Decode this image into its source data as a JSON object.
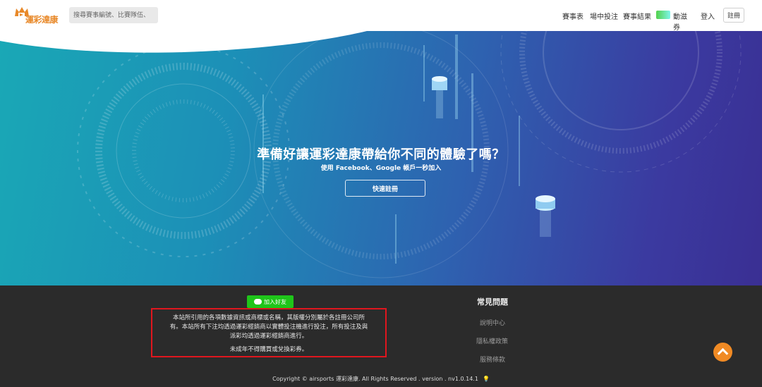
{
  "header": {
    "logo_text": "運彩達康",
    "search_placeholder": "搜尋賽事編號、比賽隊伍、",
    "nav": {
      "schedule": "賽事表",
      "betting": "場中投注",
      "results": "賽事結果",
      "promo_text": "動滋券",
      "login": "登入",
      "register": "註冊"
    }
  },
  "hero": {
    "title": "準備好讓運彩達康帶給你不同的體驗了嗎？",
    "subtitle": "使用 Facebook、Google 帳戶一秒加入",
    "button": "快速註冊"
  },
  "footer": {
    "line_button": "加入好友",
    "disclaimer_line1": "本站所引用的各項數據資訊或商標或名稱，其版權分別屬於各註冊公司所",
    "disclaimer_line2": "有。本站所有下注均透過運彩經銷商以實體投注機進行投注，所有投注及與",
    "disclaimer_line3": "派彩均透過運彩經銷商進行。",
    "disclaimer_line4": "未成年不得購買或兌換彩券。",
    "faq_title": "常見問題",
    "faq_links": [
      "說明中心",
      "隱私權政策",
      "服務條款"
    ],
    "copyright": "Copyright © airsports 運彩達康. All Rights Reserved . version . nv1.0.14.1"
  },
  "colors": {
    "brand_orange": "#e8892a",
    "line_green": "#1fc51a",
    "disclaimer_border": "#e0161e",
    "back_to_top": "#f08a24"
  },
  "icons": [
    "crown-icon",
    "line-icon",
    "bulb-icon",
    "chevron-up-icon"
  ]
}
